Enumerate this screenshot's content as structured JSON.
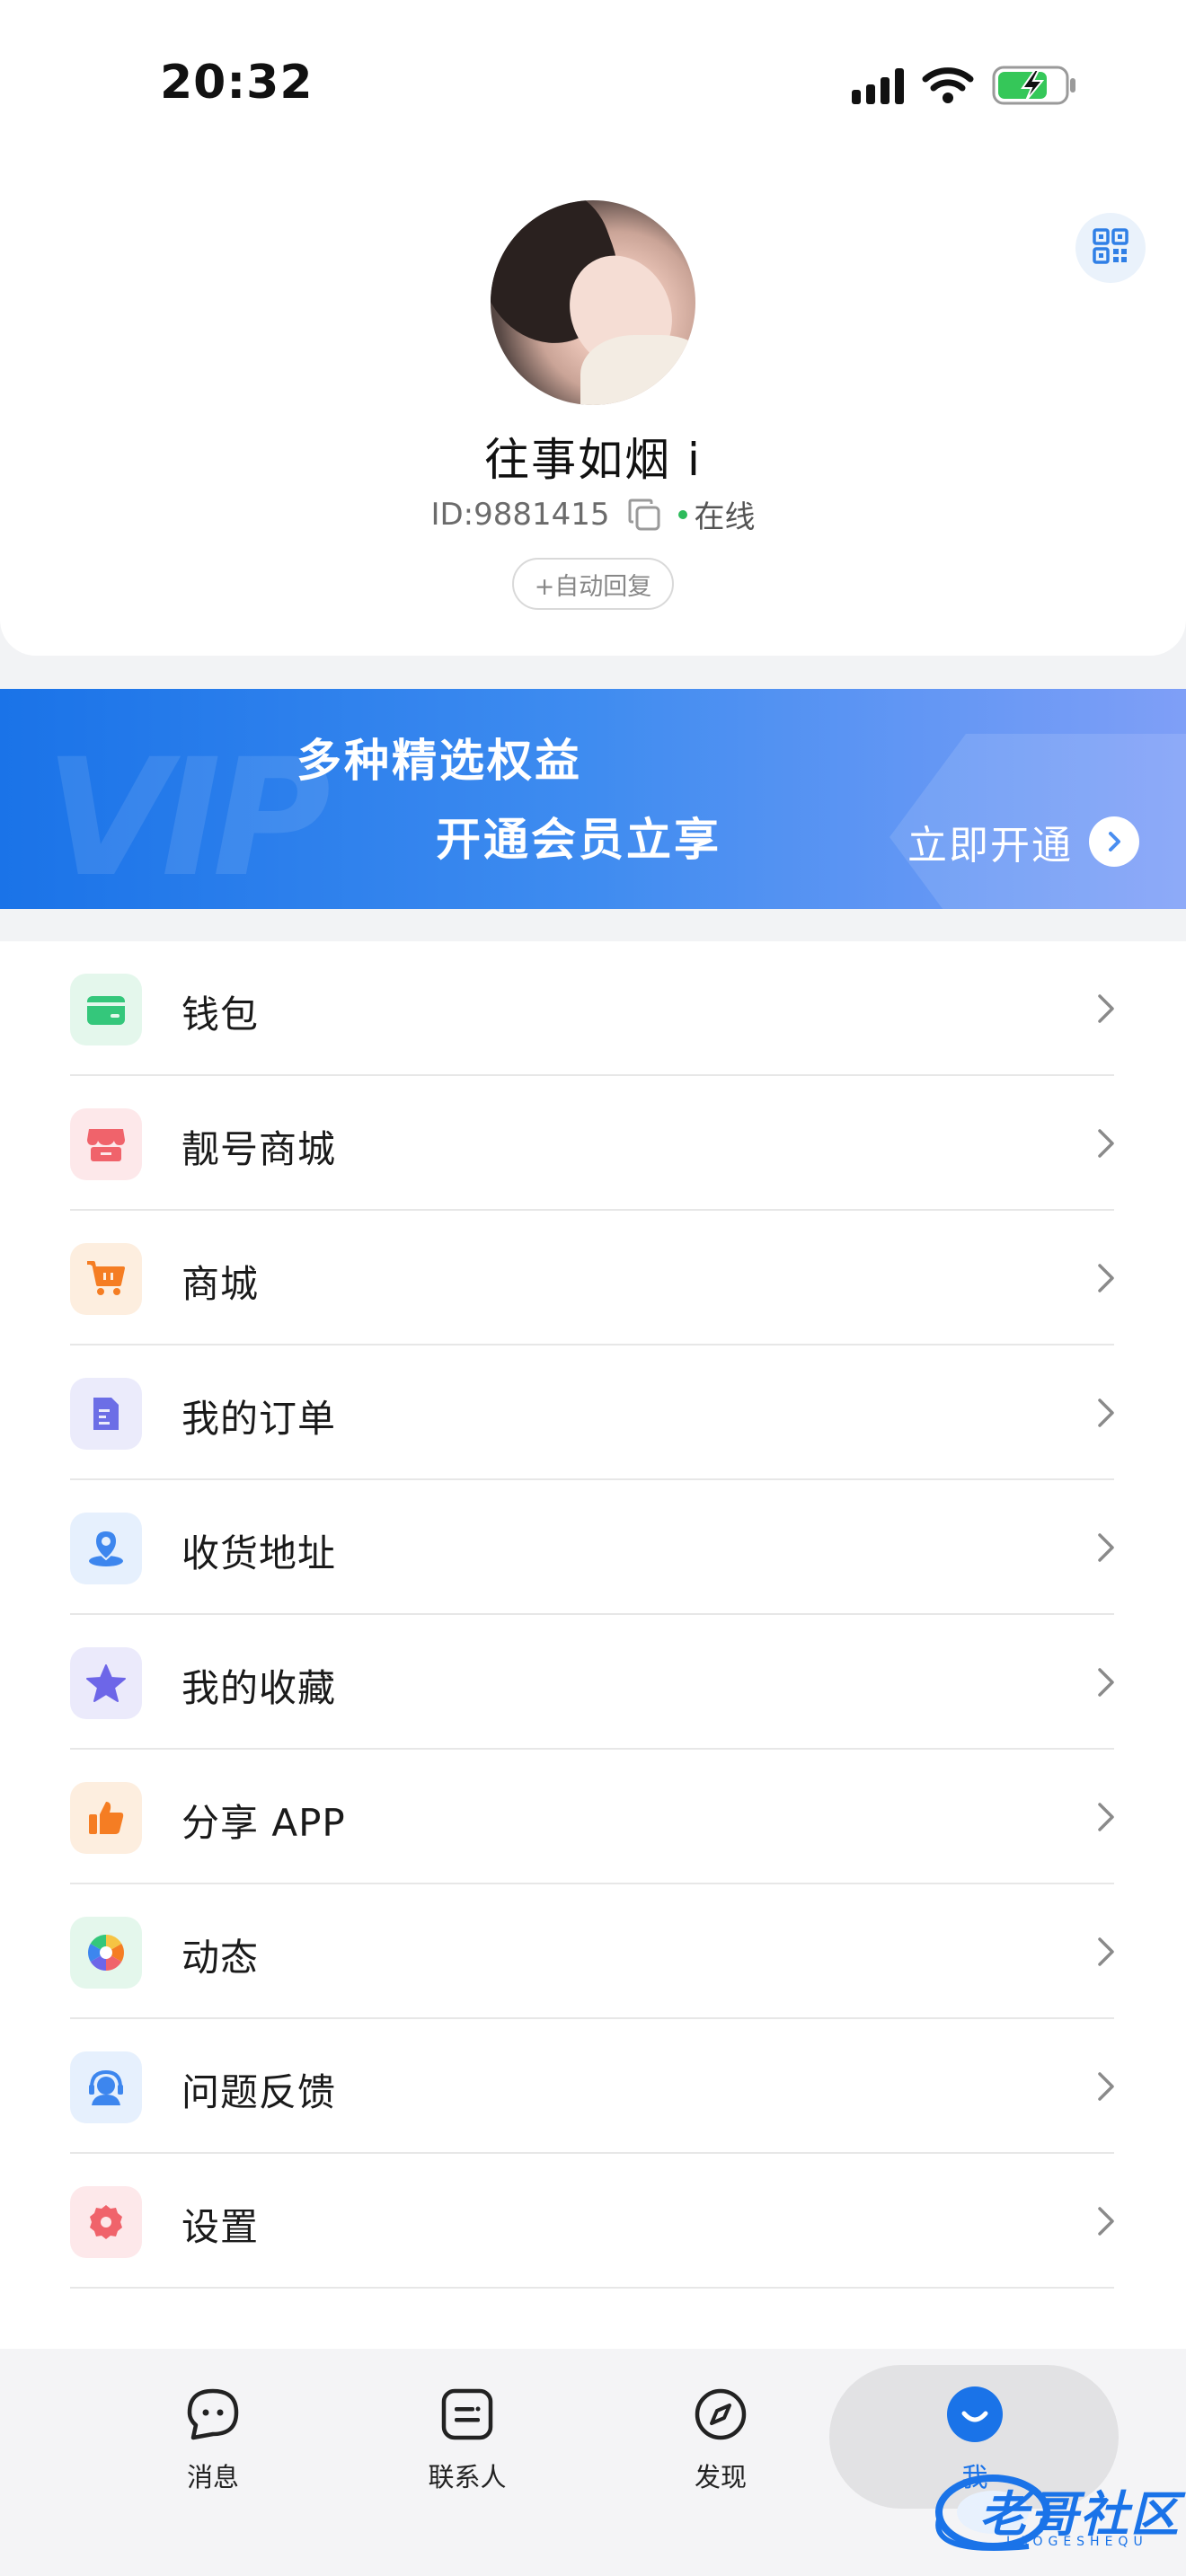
{
  "status_bar": {
    "time": "20:32",
    "icons": [
      "cellular-signal-icon",
      "wifi-icon",
      "battery-charging-icon"
    ]
  },
  "profile": {
    "nickname": "往事如烟 i",
    "id_text": "ID:9881415",
    "online_status": "在线",
    "auto_reply_label": "+自动回复",
    "qr_icon": "qr-code-icon"
  },
  "vip_banner": {
    "line1": "多种精选权益",
    "line2": "开通会员立享",
    "cta": "立即开通",
    "watermark": "VIP"
  },
  "menu": {
    "items": [
      {
        "label": "钱包",
        "icon": "wallet-icon",
        "color": "#34c77b",
        "bg": "#e4f7ec"
      },
      {
        "label": "靓号商城",
        "icon": "store-icon",
        "color": "#f0636b",
        "bg": "#fde8ea"
      },
      {
        "label": "商城",
        "icon": "shopping-cart-icon",
        "color": "#f57d23",
        "bg": "#fdeedf"
      },
      {
        "label": "我的订单",
        "icon": "order-document-icon",
        "color": "#6c6ee6",
        "bg": "#ebebfb"
      },
      {
        "label": "收货地址",
        "icon": "location-pin-icon",
        "color": "#3d86ee",
        "bg": "#e6f0fd"
      },
      {
        "label": "我的收藏",
        "icon": "star-icon",
        "color": "#6d66e8",
        "bg": "#ebeafb"
      },
      {
        "label": "分享 APP",
        "icon": "thumbs-up-icon",
        "color": "#f57d23",
        "bg": "#fdeedf"
      },
      {
        "label": "动态",
        "icon": "aperture-icon",
        "color": "#2dbb5b",
        "bg": "#e4f7ec"
      },
      {
        "label": "问题反馈",
        "icon": "customer-service-icon",
        "color": "#3d86ee",
        "bg": "#e6f0fd"
      },
      {
        "label": "设置",
        "icon": "settings-gear-icon",
        "color": "#f0636b",
        "bg": "#fde8ea"
      }
    ]
  },
  "tab_bar": {
    "tabs": [
      {
        "label": "消息",
        "icon": "chat-bubble-icon",
        "active": false
      },
      {
        "label": "联系人",
        "icon": "contacts-icon",
        "active": false
      },
      {
        "label": "发现",
        "icon": "compass-icon",
        "active": false
      },
      {
        "label": "我",
        "icon": "me-smile-icon",
        "active": true
      }
    ],
    "active_color": "#1a73e8"
  },
  "watermark": {
    "text": "老哥社区",
    "sub": "LAOGESHEQU"
  }
}
